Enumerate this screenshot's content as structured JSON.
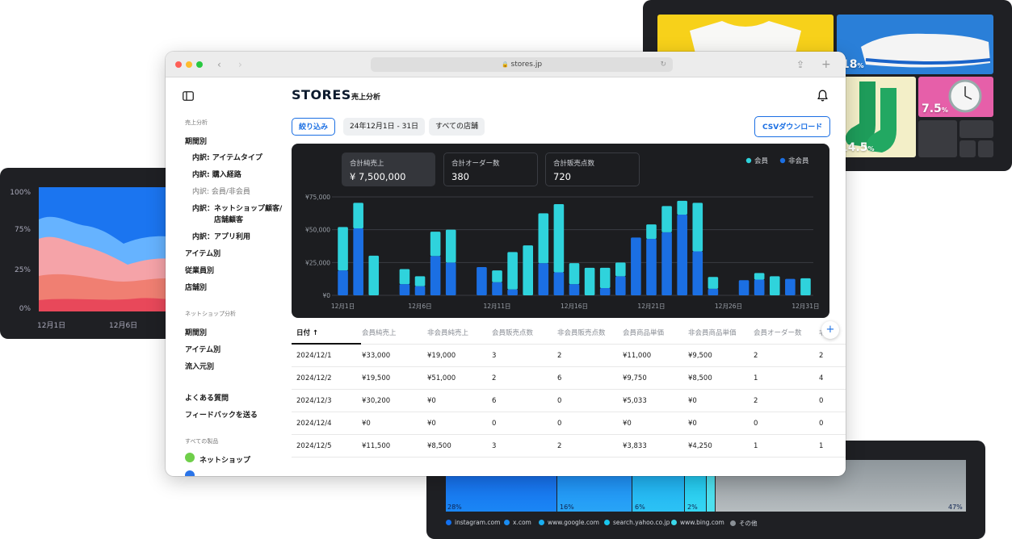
{
  "area_card": {
    "y_ticks": [
      "100%",
      "75%",
      "25%",
      "0%"
    ],
    "x_ticks": [
      "12月1日",
      "12月6日"
    ]
  },
  "product_card": {
    "tiles": [
      {
        "name": "shoe",
        "pct": "18",
        "unit": "%"
      },
      {
        "name": "watch",
        "pct": "7.5",
        "unit": "%"
      },
      {
        "name": "socks",
        "pct": "14.5",
        "unit": "%"
      }
    ]
  },
  "traffic_card": {
    "segments": [
      {
        "pct": "28%",
        "color": "#1270f0"
      },
      {
        "pct": "16%",
        "color": "#1a8cf2"
      },
      {
        "pct": "6%",
        "color": "#1aaef0"
      },
      {
        "pct": "2%",
        "color": "#18c6ee"
      },
      {
        "pct": "47%",
        "color": "#8a9096"
      }
    ],
    "legend": [
      {
        "label": "instagram.com",
        "color": "#1270f0"
      },
      {
        "label": "x.com",
        "color": "#1a8cf2"
      },
      {
        "label": "www.google.com",
        "color": "#1aaef0"
      },
      {
        "label": "search.yahoo.co.jp",
        "color": "#18c6ee"
      },
      {
        "label": "www.bing.com",
        "color": "#3ad6e8"
      },
      {
        "label": "その他",
        "color": "#8a9096"
      }
    ]
  },
  "browser": {
    "url": "stores.jp"
  },
  "sidebar": {
    "section1_caption": "売上分析",
    "items": [
      {
        "label": "期間別"
      },
      {
        "label": "内訳: アイテムタイプ"
      },
      {
        "label": "内訳: 購入経路"
      },
      {
        "label": "内訳: 会員/非会員"
      },
      {
        "label": "内訳：ネットショップ顧客/"
      },
      {
        "label": "店舗顧客"
      },
      {
        "label": "内訳：アプリ利用"
      },
      {
        "label": "アイテム別"
      },
      {
        "label": "従業員別"
      },
      {
        "label": "店舗別"
      }
    ],
    "section2_caption": "ネットショップ分析",
    "items2": [
      {
        "label": "期間別"
      },
      {
        "label": "アイテム別"
      },
      {
        "label": "流入元別"
      }
    ],
    "help": [
      {
        "label": "よくある質問"
      },
      {
        "label": "フィードバックを送る"
      }
    ],
    "products_caption": "すべての製品",
    "product": "ネットショップ"
  },
  "header": {
    "logo": "STORES",
    "title": "売上分析"
  },
  "filters": {
    "filter_button": "絞り込み",
    "date_range": "24年12月1日 - 31日",
    "store": "すべての店舗",
    "csv_button": "CSVダウンロード"
  },
  "kpis": [
    {
      "title": "合計純売上",
      "value": "¥ 7,500,000"
    },
    {
      "title": "合計オーダー数",
      "value": "380"
    },
    {
      "title": "合計販売点数",
      "value": "720"
    }
  ],
  "chart_data": {
    "type": "bar",
    "stacked": true,
    "categories": [
      "12月1日",
      "12月2日",
      "12月3日",
      "12月4日",
      "12月5日",
      "12月6日",
      "12月7日",
      "12月8日",
      "12月9日",
      "12月10日",
      "12月11日",
      "12月12日",
      "12月13日",
      "12月14日",
      "12月15日",
      "12月16日",
      "12月17日",
      "12月18日",
      "12月19日",
      "12月20日",
      "12月21日",
      "12月22日",
      "12月23日",
      "12月24日",
      "12月25日",
      "12月26日",
      "12月27日",
      "12月28日",
      "12月29日",
      "12月30日",
      "12月31日"
    ],
    "x_tick_labels": [
      "12月1日",
      "12月6日",
      "12月11日",
      "12月16日",
      "12月21日",
      "12月26日",
      "12月31日"
    ],
    "y_ticks": [
      "¥0",
      "¥25,000",
      "¥50,000",
      "¥75,000"
    ],
    "ylim": [
      0,
      75000
    ],
    "series": [
      {
        "name": "非会員",
        "color": "#1b6fe3",
        "values": [
          19000,
          51000,
          0,
          0,
          8500,
          7000,
          30000,
          25000,
          0,
          21500,
          10000,
          4500,
          0,
          24500,
          17500,
          8500,
          0,
          5500,
          14500,
          44000,
          43000,
          48000,
          61500,
          33500,
          5000,
          0,
          11500,
          12000,
          0,
          12500,
          0
        ]
      },
      {
        "name": "会員",
        "color": "#2fd3dc",
        "values": [
          33000,
          19500,
          30200,
          0,
          11500,
          7500,
          18500,
          25000,
          0,
          0,
          9000,
          28500,
          38000,
          38000,
          52000,
          16000,
          21000,
          15500,
          10500,
          0,
          11000,
          20000,
          10500,
          37000,
          9000,
          0,
          0,
          5000,
          14500,
          0,
          13000
        ]
      }
    ]
  },
  "table": {
    "columns": [
      "日付 ↑",
      "会員純売上",
      "非会員純売上",
      "会員販売点数",
      "非会員販売点数",
      "会員商品単価",
      "非会員商品単価",
      "会員オーダー数",
      "非"
    ],
    "rows": [
      [
        "2024/12/1",
        "¥33,000",
        "¥19,000",
        "3",
        "2",
        "¥11,000",
        "¥9,500",
        "2",
        "2"
      ],
      [
        "2024/12/2",
        "¥19,500",
        "¥51,000",
        "2",
        "6",
        "¥9,750",
        "¥8,500",
        "1",
        "4"
      ],
      [
        "2024/12/3",
        "¥30,200",
        "¥0",
        "6",
        "0",
        "¥5,033",
        "¥0",
        "2",
        "0"
      ],
      [
        "2024/12/4",
        "¥0",
        "¥0",
        "0",
        "0",
        "¥0",
        "¥0",
        "0",
        "0"
      ],
      [
        "2024/12/5",
        "¥11,500",
        "¥8,500",
        "3",
        "2",
        "¥3,833",
        "¥4,250",
        "1",
        "1"
      ]
    ]
  }
}
